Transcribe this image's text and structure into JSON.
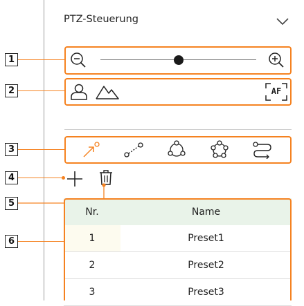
{
  "panel": {
    "title": "PTZ-Steuerung",
    "collapse_icon": "chevron-down-icon"
  },
  "callouts": [
    "1",
    "2",
    "3",
    "4",
    "5",
    "6"
  ],
  "zoom": {
    "zoom_out_icon": "zoom-out-icon",
    "zoom_in_icon": "zoom-in-icon",
    "level": 0.5
  },
  "focus_row": {
    "icons": [
      "person-icon",
      "landscape-icon",
      "autofocus-icon"
    ],
    "af_label": "AF"
  },
  "mode_row": {
    "icons": [
      "preset-arrow-icon",
      "swing-icon",
      "group-icon",
      "tour-icon",
      "trace-icon"
    ]
  },
  "preset_actions": {
    "add_icon": "plus-icon",
    "delete_icon": "trash-icon"
  },
  "table": {
    "columns": [
      "Nr.",
      "Name"
    ],
    "rows": [
      {
        "nr": "1",
        "name": "Preset1"
      },
      {
        "nr": "2",
        "name": "Preset2"
      },
      {
        "nr": "3",
        "name": "Preset3"
      }
    ]
  },
  "colors": {
    "accent": "#f58220",
    "header_bg": "#e9f3e9"
  }
}
